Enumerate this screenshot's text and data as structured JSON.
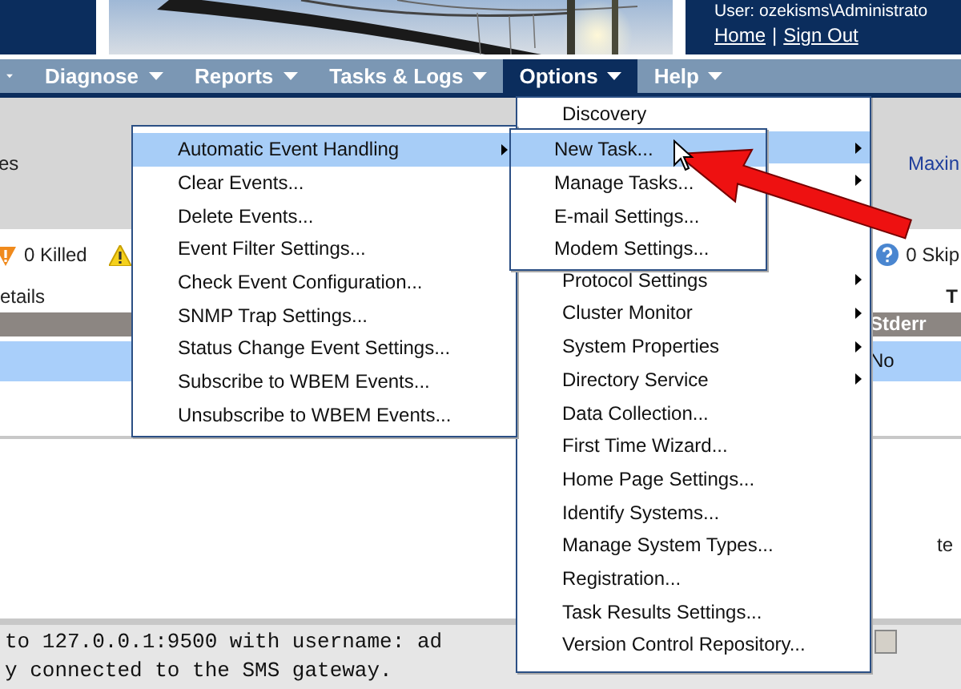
{
  "header": {
    "user": "User: ozekisms\\Administrato",
    "links": [
      {
        "label": "Home"
      },
      {
        "label": "Sign Out"
      }
    ],
    "separator": "|"
  },
  "nav": [
    {
      "selected": false
    },
    {
      "label": "Diagnose",
      "selected": false
    },
    {
      "label": "Reports",
      "selected": false
    },
    {
      "label": "Tasks & Logs",
      "selected": false
    },
    {
      "label": "Options",
      "selected": true
    },
    {
      "label": "Help",
      "selected": false
    }
  ],
  "content": {
    "left_fragment": "es",
    "right_link": "Maxin",
    "status": [
      {
        "kind": "killed",
        "label": "0 Killed"
      },
      {
        "kind": "warning"
      },
      {
        "kind": "skipped",
        "label": "0 Skip"
      }
    ],
    "details_label": "etails",
    "right_heading": "T",
    "table": {
      "columns": [
        "Stderr"
      ],
      "rows": [
        [
          "No"
        ]
      ]
    },
    "side_fragment": "te"
  },
  "console": {
    "lines": [
      "to 127.0.0.1:9500 with username: ad",
      "y connected to the SMS gateway."
    ]
  },
  "options_menu": {
    "items": [
      {
        "label": "Discovery",
        "selected": false,
        "submenu": false
      },
      {
        "selected": true,
        "submenu": true
      },
      {
        "selected": false,
        "submenu": true
      },
      {
        "selected": false
      },
      {
        "selected": false
      },
      {
        "label": "Protocol Settings",
        "selected": false,
        "submenu": true
      },
      {
        "label": "Cluster Monitor",
        "selected": false,
        "submenu": true
      },
      {
        "label": "System Properties",
        "selected": false,
        "submenu": true
      },
      {
        "label": "Directory Service",
        "selected": false,
        "submenu": true
      },
      {
        "label": "Data Collection...",
        "selected": false,
        "submenu": false
      },
      {
        "label": "First Time Wizard...",
        "selected": false,
        "submenu": false
      },
      {
        "label": "Home Page Settings...",
        "selected": false,
        "submenu": false
      },
      {
        "label": "Identify Systems...",
        "selected": false,
        "submenu": false
      },
      {
        "label": "Manage System Types...",
        "selected": false,
        "submenu": false
      },
      {
        "label": "Registration...",
        "selected": false,
        "submenu": false
      },
      {
        "label": "Task Results Settings...",
        "selected": false,
        "submenu": false
      },
      {
        "label": "Version Control Repository...",
        "selected": false,
        "submenu": false
      }
    ]
  },
  "events_menu": {
    "items": [
      {
        "label": "Automatic Event Handling",
        "selected": true,
        "submenu": true
      },
      {
        "label": "Clear Events...",
        "selected": false,
        "submenu": false
      },
      {
        "label": "Delete Events...",
        "selected": false,
        "submenu": false
      },
      {
        "label": "Event Filter Settings...",
        "selected": false,
        "submenu": false
      },
      {
        "label": "Check Event Configuration...",
        "selected": false,
        "submenu": false
      },
      {
        "label": "SNMP Trap Settings...",
        "selected": false,
        "submenu": false
      },
      {
        "label": "Status Change Event Settings...",
        "selected": false,
        "submenu": false
      },
      {
        "label": "Subscribe to WBEM Events...",
        "selected": false,
        "submenu": false
      },
      {
        "label": "Unsubscribe to WBEM Events...",
        "selected": false,
        "submenu": false
      }
    ]
  },
  "tasks_menu": {
    "items": [
      {
        "label": "New Task...",
        "selected": true
      },
      {
        "label": "Manage Tasks...",
        "selected": false
      },
      {
        "label": "E-mail Settings...",
        "selected": false
      },
      {
        "label": "Modem Settings...",
        "selected": false
      }
    ]
  }
}
